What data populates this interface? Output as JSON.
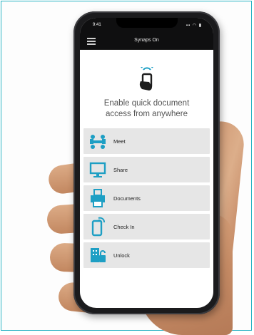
{
  "statusbar": {
    "time": "9:41",
    "icons": "▪▪ ◠ ▮"
  },
  "appbar": {
    "title": "Synaps On"
  },
  "headline": {
    "line1": "Enable quick document",
    "line2": "access from anywhere"
  },
  "menu_items": [
    {
      "label": "Meet",
      "icon": "meeting-people-icon"
    },
    {
      "label": "Share",
      "icon": "monitor-screen-icon"
    },
    {
      "label": "Documents",
      "icon": "document-printer-icon"
    },
    {
      "label": "Check In",
      "icon": "phone-checkin-icon"
    },
    {
      "label": "Unlock",
      "icon": "building-unlock-icon"
    }
  ],
  "colors": {
    "accent": "#1e9fc4",
    "frame": "#29b3c4",
    "button_bg": "#e6e6e6"
  }
}
